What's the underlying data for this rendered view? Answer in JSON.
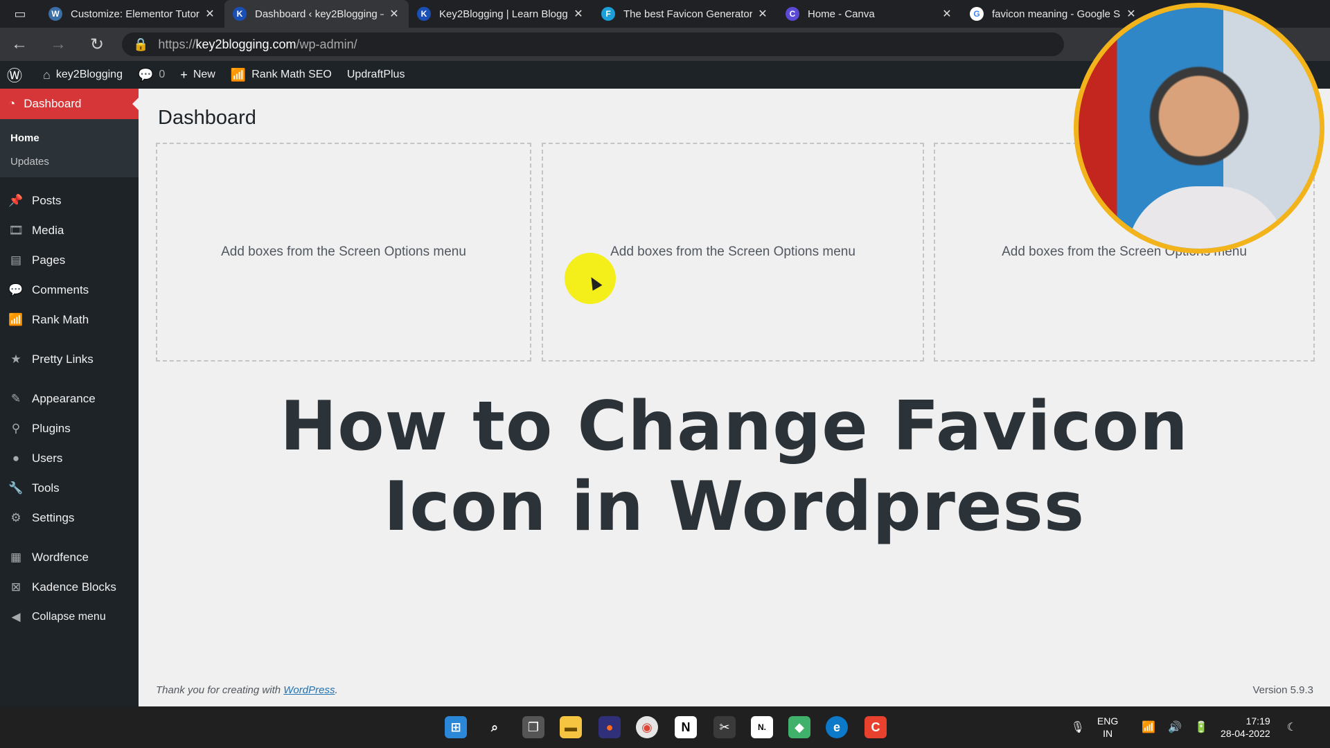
{
  "browser": {
    "tabs": [
      {
        "title": "Customize: Elementor Tutor",
        "favicon": "wordpress-favicon",
        "color": "#3b6ea5",
        "glyph": "W",
        "active": false
      },
      {
        "title": "Dashboard ‹ key2Blogging –",
        "favicon": "k2b-favicon",
        "color": "#1a4fb5",
        "glyph": "K",
        "active": true
      },
      {
        "title": "Key2Blogging | Learn Blogg",
        "favicon": "k2b-favicon",
        "color": "#1a4fb5",
        "glyph": "K",
        "active": false
      },
      {
        "title": "The best Favicon Generator",
        "favicon": "favicon-generator-favicon",
        "color": "#1a9fd8",
        "glyph": "F",
        "active": false
      },
      {
        "title": "Home - Canva",
        "favicon": "canva-favicon",
        "color": "#5b4ad6",
        "glyph": "C",
        "active": false
      },
      {
        "title": "favicon meaning - Google S",
        "favicon": "google-favicon",
        "color": "#ffffff",
        "glyph": "G",
        "active": false
      }
    ],
    "url_prefix": "https://",
    "url_host": "key2blogging.com",
    "url_path": "/wp-admin/"
  },
  "adminbar": {
    "site": "key2Blogging",
    "comments_count": "0",
    "new_label": "New",
    "rankmath_label": "Rank Math SEO",
    "updraft_label": "UpdraftPlus"
  },
  "sidebar": {
    "dashboard_label": "Dashboard",
    "submenu": [
      "Home",
      "Updates"
    ],
    "items": [
      {
        "label": "Posts",
        "icon": "pin-icon"
      },
      {
        "label": "Media",
        "icon": "media-icon"
      },
      {
        "label": "Pages",
        "icon": "pages-icon"
      },
      {
        "label": "Comments",
        "icon": "comment-icon"
      },
      {
        "label": "Rank Math",
        "icon": "chart-icon"
      },
      {
        "label": "Pretty Links",
        "icon": "star-icon"
      },
      {
        "label": "Appearance",
        "icon": "brush-icon"
      },
      {
        "label": "Plugins",
        "icon": "plug-icon"
      },
      {
        "label": "Users",
        "icon": "user-icon"
      },
      {
        "label": "Tools",
        "icon": "wrench-icon"
      },
      {
        "label": "Settings",
        "icon": "settings-icon"
      },
      {
        "label": "Wordfence",
        "icon": "wordfence-icon"
      },
      {
        "label": "Kadence Blocks",
        "icon": "kadence-icon"
      },
      {
        "label": "Collapse menu",
        "icon": "collapse-icon"
      }
    ]
  },
  "main": {
    "title": "Dashboard",
    "boxes": [
      {
        "text": "Add boxes from the Screen Options menu"
      },
      {
        "text": "Add boxes from the Screen Options menu"
      },
      {
        "text": "Add boxes from the Screen Options menu"
      }
    ],
    "overlay_heading_line1": "How to Change Favicon",
    "overlay_heading_line2": "Icon in Wordpress",
    "footer_text": "Thank you for creating with ",
    "footer_link": "WordPress",
    "footer_end": ".",
    "version": "Version 5.9.3"
  },
  "taskbar": {
    "lang_top": "ENG",
    "lang_bottom": "IN",
    "time": "17:19",
    "date": "28-04-2022"
  }
}
